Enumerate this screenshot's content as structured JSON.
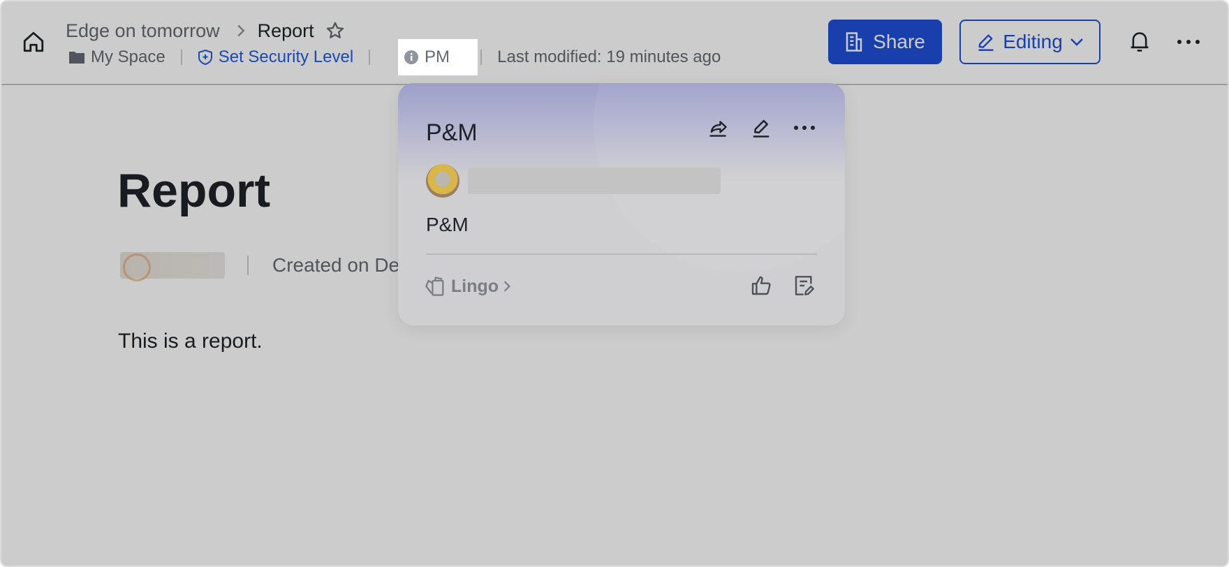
{
  "header": {
    "breadcrumb_parent": "Edge on tomorrow",
    "breadcrumb_current": "Report",
    "location": "My Space",
    "security": "Set Security Level",
    "tag": "PM",
    "last_modified": "Last modified: 19 minutes ago",
    "share_label": "Share",
    "edit_label": "Editing"
  },
  "doc": {
    "title": "Report",
    "created": "Created on De",
    "body": "This is a report."
  },
  "popover": {
    "title": "P&M",
    "description": "P&M",
    "lingo_label": "Lingo"
  },
  "colors": {
    "accent": "#1e4fd6",
    "security": "#245bdb",
    "hero_top": "#9e9fc9"
  },
  "icons": [
    "home-icon",
    "chevron-right-icon",
    "star-icon",
    "folder-icon",
    "shield-icon",
    "info-icon",
    "building-icon",
    "pencil-icon",
    "chevron-down-icon",
    "bell-icon",
    "more-icon",
    "share-out-icon",
    "edit-icon",
    "lingo-icon",
    "thumbs-up-icon",
    "note-edit-icon"
  ]
}
